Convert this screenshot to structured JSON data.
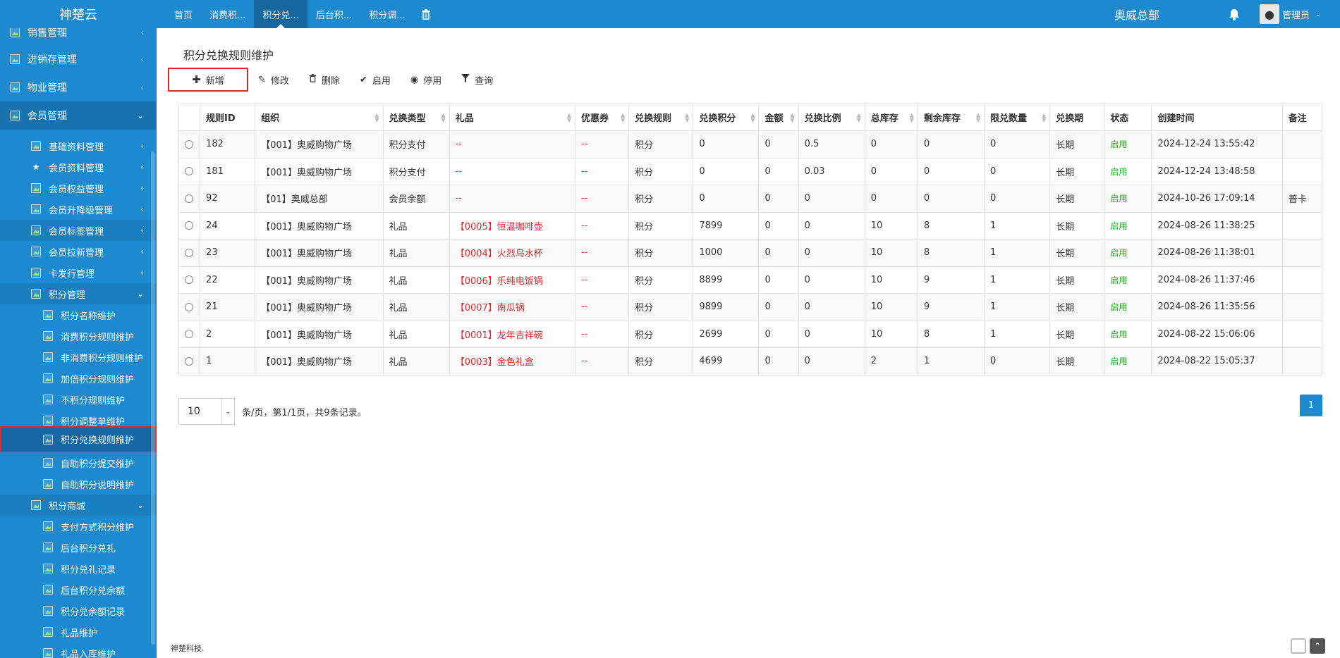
{
  "app": {
    "brand": "神楚云",
    "org": "奥威总部",
    "user": "管理员"
  },
  "tabs": [
    {
      "label": "首页"
    },
    {
      "label": "消费积..."
    },
    {
      "label": "积分兑..."
    },
    {
      "label": "后台积..."
    },
    {
      "label": "积分调..."
    }
  ],
  "sidebar": {
    "items": [
      {
        "label": "销售管理"
      },
      {
        "label": "进销存管理"
      },
      {
        "label": "物业管理"
      },
      {
        "label": "会员管理"
      },
      {
        "label": "基础资料管理"
      },
      {
        "label": "会员资料管理"
      },
      {
        "label": "会员权益管理"
      },
      {
        "label": "会员升降级管理"
      },
      {
        "label": "会员标签管理"
      },
      {
        "label": "会员拉新管理"
      },
      {
        "label": "卡发行管理"
      },
      {
        "label": "积分管理"
      },
      {
        "label": "积分名称维护"
      },
      {
        "label": "消费积分规则维护"
      },
      {
        "label": "非消费积分规则维护"
      },
      {
        "label": "加倍积分规则维护"
      },
      {
        "label": "不积分规则维护"
      },
      {
        "label": "积分调整单维护"
      },
      {
        "label": "积分兑换规则维护"
      },
      {
        "label": "自助积分提交维护"
      },
      {
        "label": "自助积分说明维护"
      },
      {
        "label": "积分商城"
      },
      {
        "label": "支付方式积分维护"
      },
      {
        "label": "后台积分兑礼"
      },
      {
        "label": "积分兑礼记录"
      },
      {
        "label": "后台积分兑余额"
      },
      {
        "label": "积分兑余额记录"
      },
      {
        "label": "礼品维护"
      },
      {
        "label": "礼品入库维护"
      }
    ]
  },
  "page": {
    "title": "积分兑换规则维护"
  },
  "toolbar": {
    "add": "新增",
    "edit": "修改",
    "delete": "删除",
    "enable": "启用",
    "disable": "停用",
    "query": "查询"
  },
  "table": {
    "headers": [
      "规则ID",
      "组织",
      "兑换类型",
      "礼品",
      "优惠券",
      "兑换规则",
      "兑换积分",
      "金额",
      "兑换比例",
      "总库存",
      "剩余库存",
      "限兑数量",
      "兑换期",
      "状态",
      "创建时间",
      "备注"
    ],
    "rows": [
      {
        "id": "182",
        "org": "【001】奥威购物广场",
        "type": "积分支付",
        "gift": "--",
        "coupon": "--",
        "rule": "积分",
        "points": "0",
        "amount": "0",
        "ratio": "0.5",
        "total": "0",
        "remain": "0",
        "limit": "0",
        "period": "长期",
        "status": "启用",
        "created": "2024-12-24 13:55:42",
        "note": ""
      },
      {
        "id": "181",
        "org": "【001】奥威购物广场",
        "type": "积分支付",
        "gift": "--",
        "coupon": "--",
        "rule": "积分",
        "points": "0",
        "amount": "0",
        "ratio": "0.03",
        "total": "0",
        "remain": "0",
        "limit": "0",
        "period": "长期",
        "status": "启用",
        "created": "2024-12-24 13:48:58",
        "note": ""
      },
      {
        "id": "92",
        "org": "【01】奥威总部",
        "type": "会员余额",
        "gift": "--",
        "coupon": "--",
        "rule": "积分",
        "points": "0",
        "amount": "0",
        "ratio": "0",
        "total": "0",
        "remain": "0",
        "limit": "0",
        "period": "长期",
        "status": "启用",
        "created": "2024-10-26 17:09:14",
        "note": "普卡"
      },
      {
        "id": "24",
        "org": "【001】奥威购物广场",
        "type": "礼品",
        "gift": "【0005】恒温咖啡壶",
        "coupon": "--",
        "rule": "积分",
        "points": "7899",
        "amount": "0",
        "ratio": "0",
        "total": "10",
        "remain": "8",
        "limit": "1",
        "period": "长期",
        "status": "启用",
        "created": "2024-08-26 11:38:25",
        "note": ""
      },
      {
        "id": "23",
        "org": "【001】奥威购物广场",
        "type": "礼品",
        "gift": "【0004】火烈鸟水杯",
        "coupon": "--",
        "rule": "积分",
        "points": "1000",
        "amount": "0",
        "ratio": "0",
        "total": "10",
        "remain": "8",
        "limit": "1",
        "period": "长期",
        "status": "启用",
        "created": "2024-08-26 11:38:01",
        "note": ""
      },
      {
        "id": "22",
        "org": "【001】奥威购物广场",
        "type": "礼品",
        "gift": "【0006】乐纯电饭锅",
        "coupon": "--",
        "rule": "积分",
        "points": "8899",
        "amount": "0",
        "ratio": "0",
        "total": "10",
        "remain": "9",
        "limit": "1",
        "period": "长期",
        "status": "启用",
        "created": "2024-08-26 11:37:46",
        "note": ""
      },
      {
        "id": "21",
        "org": "【001】奥威购物广场",
        "type": "礼品",
        "gift": "【0007】南瓜锅",
        "coupon": "--",
        "rule": "积分",
        "points": "9899",
        "amount": "0",
        "ratio": "0",
        "total": "10",
        "remain": "9",
        "limit": "1",
        "period": "长期",
        "status": "启用",
        "created": "2024-08-26 11:35:56",
        "note": ""
      },
      {
        "id": "2",
        "org": "【001】奥威购物广场",
        "type": "礼品",
        "gift": "【0001】龙年吉祥碗",
        "coupon": "--",
        "rule": "积分",
        "points": "2699",
        "amount": "0",
        "ratio": "0",
        "total": "10",
        "remain": "8",
        "limit": "1",
        "period": "长期",
        "status": "启用",
        "created": "2024-08-22 15:06:06",
        "note": ""
      },
      {
        "id": "1",
        "org": "【001】奥威购物广场",
        "type": "礼品",
        "gift": "【0003】金色礼盒",
        "coupon": "--",
        "rule": "积分",
        "points": "4699",
        "amount": "0",
        "ratio": "0",
        "total": "2",
        "remain": "1",
        "limit": "0",
        "period": "长期",
        "status": "启用",
        "created": "2024-08-22 15:05:37",
        "note": ""
      }
    ]
  },
  "pager": {
    "size": "10",
    "text": "条/页，第1/1页，共9条记录。",
    "page": "1"
  },
  "footer": {
    "text": "神楚科技."
  },
  "colors": {
    "primary": "#1d89cf",
    "highlight": "#e5262b",
    "status_green": "#2aa82a"
  }
}
